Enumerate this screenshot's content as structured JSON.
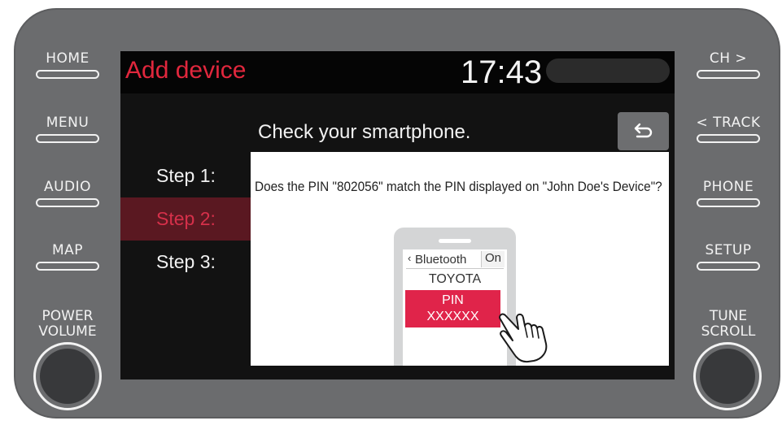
{
  "hardware": {
    "left_buttons": [
      "HOME",
      "MENU",
      "AUDIO",
      "MAP"
    ],
    "right_buttons": [
      "CH >",
      "< TRACK",
      "PHONE",
      "SETUP"
    ],
    "left_knob": [
      "POWER",
      "VOLUME"
    ],
    "right_knob": [
      "TUNE",
      "SCROLL"
    ]
  },
  "screen": {
    "title": "Add device",
    "clock": "17:43",
    "prompt": "Check your smartphone.",
    "back_icon": "return-arrow-icon",
    "steps": [
      "Step 1:",
      "Step 2:",
      "Step 3:"
    ],
    "active_step": 1,
    "question": "Does the PIN \"802056\" match the PIN displayed on \"John Doe's Device\"?",
    "illustration": {
      "bluetooth_label": "Bluetooth",
      "bluetooth_state": "On",
      "device_name": "TOYOTA",
      "pin_line1": "PIN",
      "pin_line2": "XXXXXX"
    }
  },
  "colors": {
    "title": "#e1273d",
    "active_step_bg": "#5a1821",
    "pin_button": "#e0244a",
    "bezel": "#6b6c6e"
  }
}
